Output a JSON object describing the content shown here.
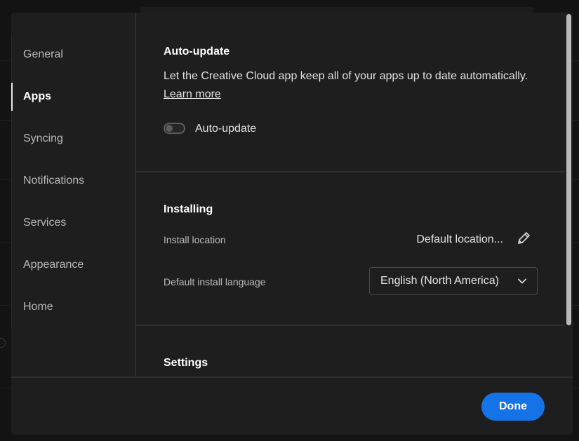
{
  "sidebar": {
    "items": [
      {
        "label": "General"
      },
      {
        "label": "Apps"
      },
      {
        "label": "Syncing"
      },
      {
        "label": "Notifications"
      },
      {
        "label": "Services"
      },
      {
        "label": "Appearance"
      },
      {
        "label": "Home"
      }
    ],
    "active": "Apps"
  },
  "auto_update": {
    "title": "Auto-update",
    "description": "Let the Creative Cloud app keep all of your apps up to date automatically.",
    "learn_more": "Learn more",
    "toggle_label": "Auto-update",
    "enabled": false
  },
  "installing": {
    "title": "Installing",
    "install_location_label": "Install location",
    "install_location_value": "Default location...",
    "language_label": "Default install language",
    "language_value": "English (North America)"
  },
  "settings": {
    "title": "Settings"
  },
  "footer": {
    "done_label": "Done"
  },
  "colors": {
    "accent": "#1473e6",
    "background": "#1e1e1e"
  },
  "icons": [
    "pencil-icon",
    "chevron-down-icon"
  ]
}
